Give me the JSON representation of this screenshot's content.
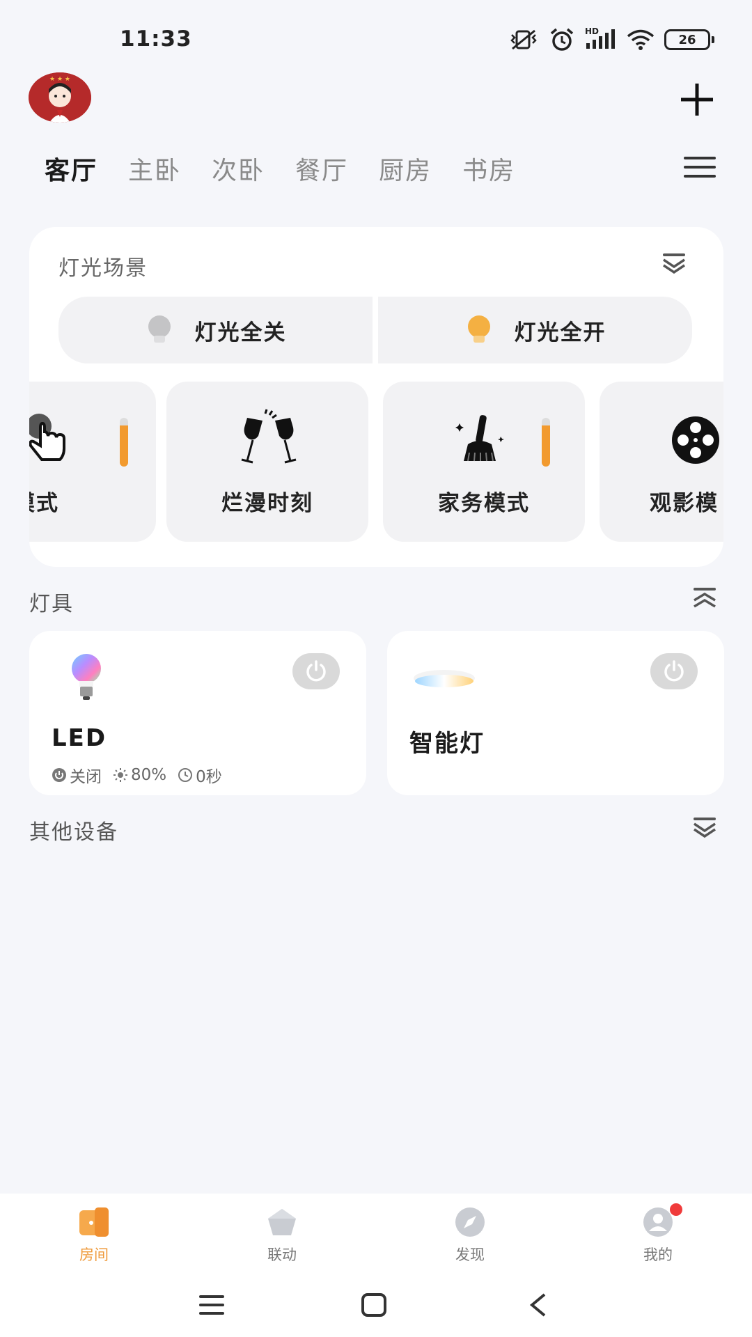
{
  "status_bar": {
    "time": "11:33",
    "battery": "26",
    "network": "HD"
  },
  "header": {
    "avatar": "user-avatar",
    "add_icon": "plus-icon",
    "menu_icon": "hamburger-menu-icon"
  },
  "rooms": {
    "tabs": [
      {
        "label": "客厅",
        "active": true
      },
      {
        "label": "主卧",
        "active": false
      },
      {
        "label": "次卧",
        "active": false
      },
      {
        "label": "餐厅",
        "active": false
      },
      {
        "label": "厨房",
        "active": false
      },
      {
        "label": "书房",
        "active": false
      }
    ]
  },
  "scenes": {
    "title": "灯光场景",
    "all_off": "灯光全关",
    "all_on": "灯光全开",
    "items": [
      {
        "label": "常模式",
        "icon": "hand-pointer-icon",
        "level": 0.85
      },
      {
        "label": "烂漫时刻",
        "icon": "wine-glasses-icon"
      },
      {
        "label": "家务模式",
        "icon": "broom-icon",
        "level": 0.85
      },
      {
        "label": "观影模",
        "icon": "film-reel-icon"
      }
    ]
  },
  "lamps": {
    "title": "灯具",
    "devices": [
      {
        "name": "LED",
        "icon": "color-bulb-icon",
        "power_status": "关闭",
        "brightness": "80%",
        "timer": "0秒"
      },
      {
        "name": "智能灯",
        "icon": "ceiling-light-icon"
      }
    ]
  },
  "other": {
    "title": "其他设备"
  },
  "bottom_nav": [
    {
      "label": "房间",
      "icon": "door-icon",
      "active": true
    },
    {
      "label": "联动",
      "icon": "pentagon-icon",
      "active": false
    },
    {
      "label": "发现",
      "icon": "compass-icon",
      "active": false
    },
    {
      "label": "我的",
      "icon": "profile-icon",
      "active": false,
      "badge": true
    }
  ],
  "colors": {
    "accent": "#ef9a3b",
    "background": "#f5f6fa",
    "card": "#ffffff",
    "tile": "#f2f2f4",
    "badge": "#f03b3b"
  }
}
